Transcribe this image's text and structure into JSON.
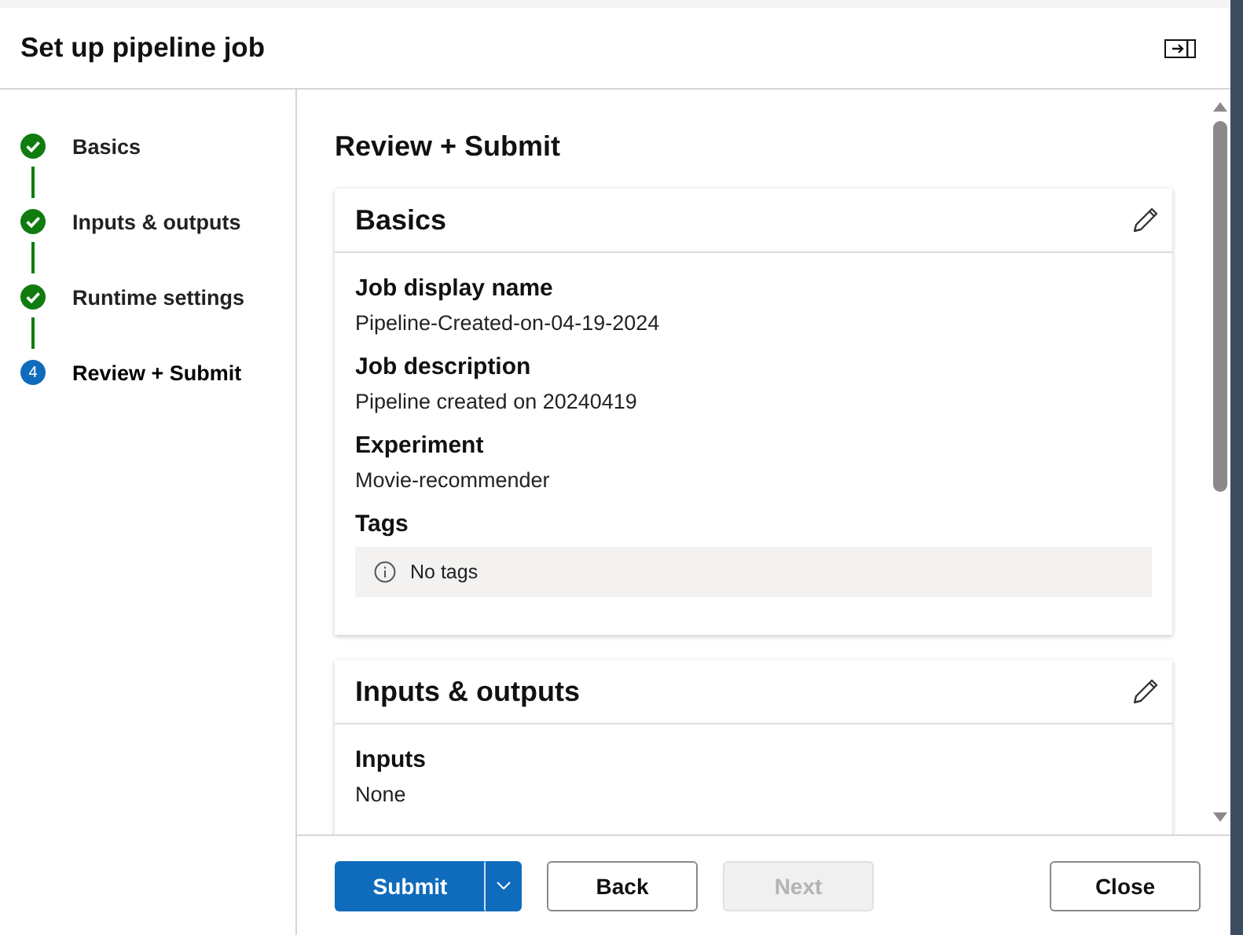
{
  "dialog": {
    "title": "Set up pipeline job"
  },
  "steps": [
    {
      "label": "Basics",
      "completed": true,
      "selected": false
    },
    {
      "label": "Inputs & outputs",
      "completed": true,
      "selected": false
    },
    {
      "label": "Runtime settings",
      "completed": true,
      "selected": false
    },
    {
      "label": "Review + Submit",
      "completed": false,
      "selected": true,
      "number": "4"
    }
  ],
  "content": {
    "heading": "Review + Submit",
    "sections": [
      {
        "title": "Basics",
        "fields": [
          {
            "kind": "text",
            "label": "Job display name",
            "value": "Pipeline-Created-on-04-19-2024"
          },
          {
            "kind": "text",
            "label": "Job description",
            "value": "Pipeline created on 20240419"
          },
          {
            "kind": "text",
            "label": "Experiment",
            "value": "Movie-recommender"
          },
          {
            "kind": "notice",
            "label": "Tags",
            "value": "No tags"
          }
        ]
      },
      {
        "title": "Inputs & outputs",
        "fields": [
          {
            "kind": "text",
            "label": "Inputs",
            "value": "None"
          }
        ]
      }
    ]
  },
  "footer": {
    "actions": [
      {
        "label": "Submit",
        "kind": "split",
        "disabled": false
      },
      {
        "label": "Back",
        "kind": "default",
        "disabled": false
      },
      {
        "label": "Next",
        "kind": "default",
        "disabled": true
      }
    ],
    "close": {
      "label": "Close"
    }
  }
}
